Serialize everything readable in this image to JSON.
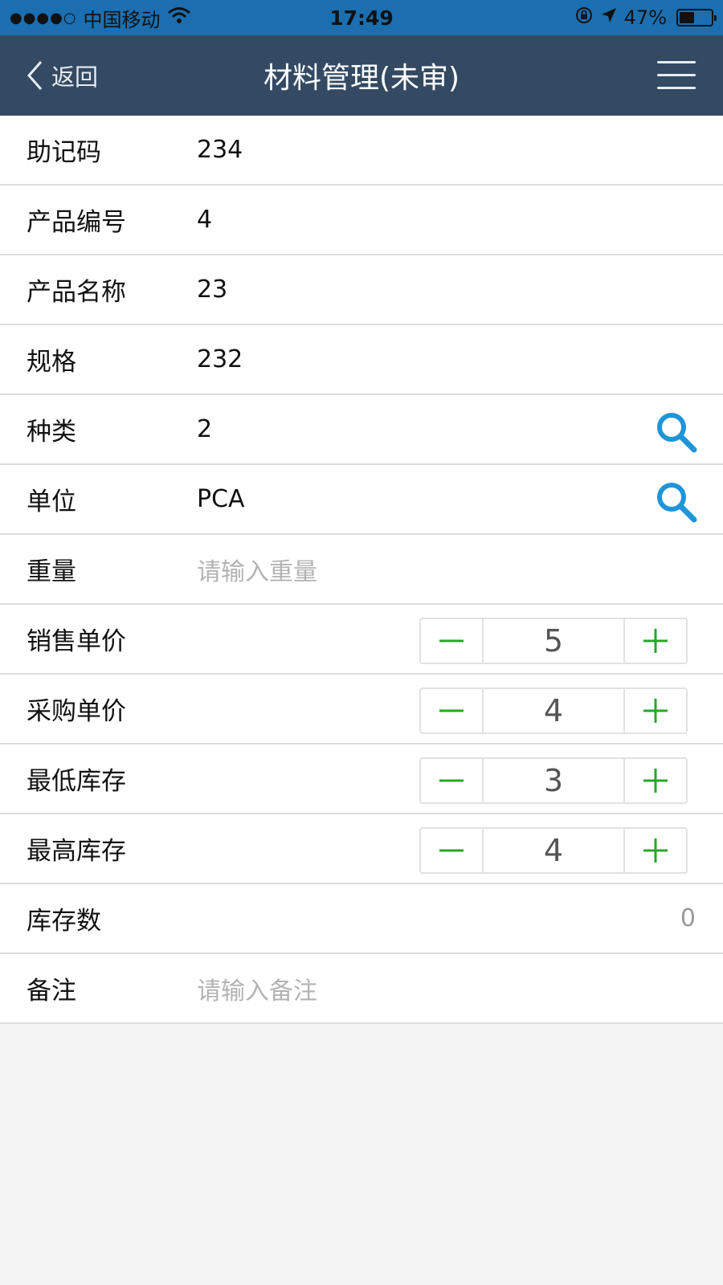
{
  "status_bar": {
    "carrier": "中国移动",
    "time": "17:49",
    "battery_percent_text": "47%",
    "battery_level": 0.47,
    "icons": [
      "signal-dots-icon",
      "wifi-icon",
      "rotation-lock-icon",
      "location-arrow-icon",
      "battery-icon"
    ]
  },
  "nav": {
    "back_label": "返回",
    "title": "材料管理(未审)",
    "menu_icon": "hamburger-menu-icon"
  },
  "form": {
    "mnemonic": {
      "label": "助记码",
      "value": "234"
    },
    "product_code": {
      "label": "产品编号",
      "value": "4"
    },
    "product_name": {
      "label": "产品名称",
      "value": "23"
    },
    "spec": {
      "label": "规格",
      "value": "232"
    },
    "category": {
      "label": "种类",
      "value": "2",
      "icon": "search-icon"
    },
    "unit": {
      "label": "单位",
      "value": "PCA",
      "icon": "search-icon"
    },
    "weight": {
      "label": "重量",
      "placeholder": "请输入重量"
    },
    "sale_price": {
      "label": "销售单价",
      "value": "5"
    },
    "purchase_price": {
      "label": "采购单价",
      "value": "4"
    },
    "min_stock": {
      "label": "最低库存",
      "value": "3"
    },
    "max_stock": {
      "label": "最高库存",
      "value": "4"
    },
    "stock_count": {
      "label": "库存数",
      "value": "0"
    },
    "remark": {
      "label": "备注",
      "placeholder": "请输入备注"
    }
  },
  "colors": {
    "status_bar_bg": "#1b6fb0",
    "nav_bg": "#344a63",
    "search_icon": "#1f95d8",
    "stepper_icon": "#2aa52a",
    "page_bg": "#f4f4f4"
  }
}
